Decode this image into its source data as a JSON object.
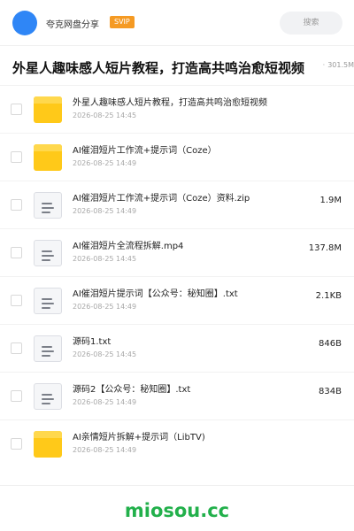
{
  "header": {
    "username": "夸克网盘分享",
    "badge": "SVIP",
    "search_placeholder": "搜索"
  },
  "share": {
    "title": "外星人趣味感人短片教程，打造高共鸣治愈短视频",
    "meta_prefix": "",
    "meta_size": "301.5M"
  },
  "files": [
    {
      "type": "folder",
      "name": "外星人趣味感人短片教程，打造高共鸣治愈短视频",
      "date": "2026-08-25 14:45",
      "size": ""
    },
    {
      "type": "folder",
      "name": "AI催泪短片工作流+提示词（Coze）",
      "date": "2026-08-25 14:49",
      "size": ""
    },
    {
      "type": "doc",
      "name": "AI催泪短片工作流+提示词（Coze）资料.zip",
      "date": "2026-08-25 14:49",
      "size": "1.9M"
    },
    {
      "type": "doc",
      "name": "AI催泪短片全流程拆解.mp4",
      "date": "2026-08-25 14:45",
      "size": "137.8M"
    },
    {
      "type": "doc",
      "name": "AI催泪短片提示词【公众号：秘知圈】.txt",
      "date": "2026-08-25 14:49",
      "size": "2.1KB"
    },
    {
      "type": "doc",
      "name": "源码1.txt",
      "date": "2026-08-25 14:45",
      "size": "846B"
    },
    {
      "type": "doc",
      "name": "源码2【公众号：秘知圈】.txt",
      "date": "2026-08-25 14:49",
      "size": "834B"
    },
    {
      "type": "folder",
      "name": "AI亲情短片拆解+提示词（LibTV)",
      "date": "2026-08-25 14:49",
      "size": ""
    }
  ],
  "footer": {
    "watermark": "miosou.cc"
  },
  "colors": {
    "avatar": "#2f86f6",
    "badge": "#f59a23",
    "folder": "#ffc919",
    "watermark": "#22b04b"
  }
}
